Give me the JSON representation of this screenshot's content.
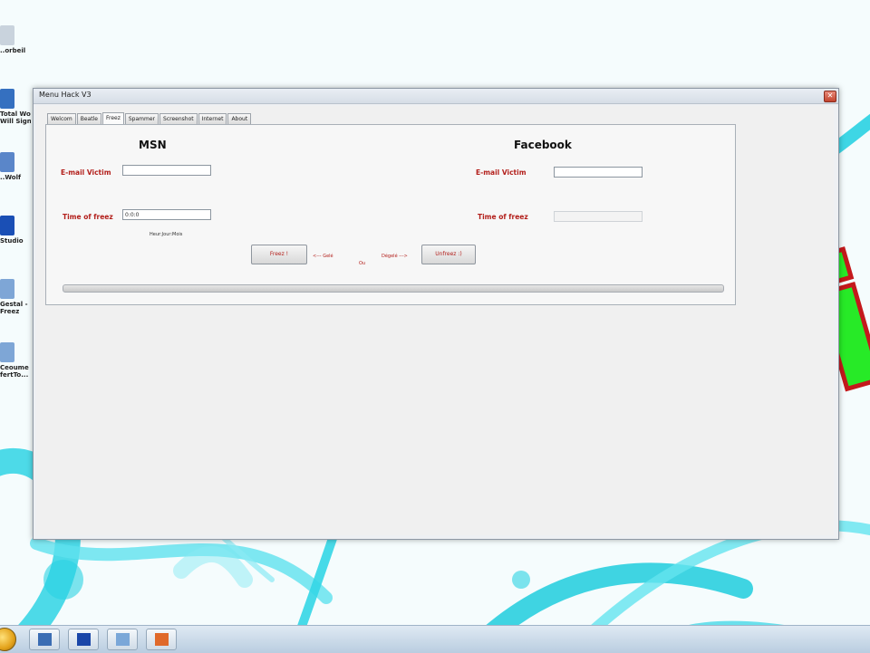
{
  "window": {
    "title": "Menu Hack V3",
    "close_glyph": "✕"
  },
  "tabs": [
    {
      "label": "Welcom"
    },
    {
      "label": "Beatle"
    },
    {
      "label": "Freez"
    },
    {
      "label": "Spammer"
    },
    {
      "label": "Screenshot"
    },
    {
      "label": "Internet"
    },
    {
      "label": "About"
    }
  ],
  "active_tab": "Freez",
  "msn": {
    "heading": "MSN",
    "email_label": "E-mail Victim",
    "email_value": "",
    "time_label": "Time of freez",
    "time_value": "0:0:0",
    "time_hint": "Heur:Jour:Mois"
  },
  "facebook": {
    "heading": "Facebook",
    "email_label": "E-mail Victim",
    "email_value": "",
    "time_label": "Time of freez",
    "time_value": ""
  },
  "actions": {
    "freez_button": "Freez !",
    "left_note": "<--- Gelé",
    "middle_note": "Ou",
    "right_note": "Dégelé --->",
    "unfreez_button": "Unfreez :)"
  },
  "progress": {
    "value": 0
  },
  "wallpaper": {
    "text": "WAPi",
    "fill_color": "#27ea27",
    "stroke_color": "#c4191c"
  },
  "desktop_icons": [
    {
      "name": "recycle-bin-icon",
      "caption": "..orbeil",
      "color": "#c9d3dd"
    },
    {
      "name": "computer-icon",
      "caption": "Total Wood\nWill Sign...",
      "color": "#3570c0"
    },
    {
      "name": "media-player-icon",
      "caption": "..Wolf",
      "color": "#5a86c9"
    },
    {
      "name": "studio-app-icon",
      "caption": "Studio",
      "color": "#1a4fb5"
    },
    {
      "name": "shortcut-icon",
      "caption": "Gestal -\nFreez",
      "color": "#7ea6d6"
    },
    {
      "name": "shortcut-icon",
      "caption": "Ceoume\nfertTo...",
      "color": "#7ea6d6"
    }
  ],
  "taskbar": {
    "items": [
      {
        "name": "taskbar-explorer-icon",
        "color": "#3b6db3"
      },
      {
        "name": "taskbar-app-icon",
        "color": "#1a46a8"
      },
      {
        "name": "taskbar-window-icon",
        "color": "#7aa7d8"
      },
      {
        "name": "taskbar-office-icon",
        "color": "#e0692a"
      }
    ]
  }
}
